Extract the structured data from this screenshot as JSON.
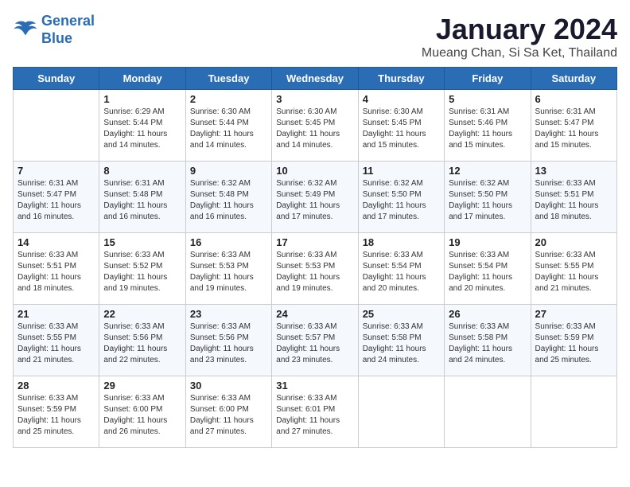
{
  "header": {
    "logo_line1": "General",
    "logo_line2": "Blue",
    "month": "January 2024",
    "location": "Mueang Chan, Si Sa Ket, Thailand"
  },
  "days_of_week": [
    "Sunday",
    "Monday",
    "Tuesday",
    "Wednesday",
    "Thursday",
    "Friday",
    "Saturday"
  ],
  "weeks": [
    [
      {
        "day": "",
        "info": ""
      },
      {
        "day": "1",
        "info": "Sunrise: 6:29 AM\nSunset: 5:44 PM\nDaylight: 11 hours\nand 14 minutes."
      },
      {
        "day": "2",
        "info": "Sunrise: 6:30 AM\nSunset: 5:44 PM\nDaylight: 11 hours\nand 14 minutes."
      },
      {
        "day": "3",
        "info": "Sunrise: 6:30 AM\nSunset: 5:45 PM\nDaylight: 11 hours\nand 14 minutes."
      },
      {
        "day": "4",
        "info": "Sunrise: 6:30 AM\nSunset: 5:45 PM\nDaylight: 11 hours\nand 15 minutes."
      },
      {
        "day": "5",
        "info": "Sunrise: 6:31 AM\nSunset: 5:46 PM\nDaylight: 11 hours\nand 15 minutes."
      },
      {
        "day": "6",
        "info": "Sunrise: 6:31 AM\nSunset: 5:47 PM\nDaylight: 11 hours\nand 15 minutes."
      }
    ],
    [
      {
        "day": "7",
        "info": "Sunrise: 6:31 AM\nSunset: 5:47 PM\nDaylight: 11 hours\nand 16 minutes."
      },
      {
        "day": "8",
        "info": "Sunrise: 6:31 AM\nSunset: 5:48 PM\nDaylight: 11 hours\nand 16 minutes."
      },
      {
        "day": "9",
        "info": "Sunrise: 6:32 AM\nSunset: 5:48 PM\nDaylight: 11 hours\nand 16 minutes."
      },
      {
        "day": "10",
        "info": "Sunrise: 6:32 AM\nSunset: 5:49 PM\nDaylight: 11 hours\nand 17 minutes."
      },
      {
        "day": "11",
        "info": "Sunrise: 6:32 AM\nSunset: 5:50 PM\nDaylight: 11 hours\nand 17 minutes."
      },
      {
        "day": "12",
        "info": "Sunrise: 6:32 AM\nSunset: 5:50 PM\nDaylight: 11 hours\nand 17 minutes."
      },
      {
        "day": "13",
        "info": "Sunrise: 6:33 AM\nSunset: 5:51 PM\nDaylight: 11 hours\nand 18 minutes."
      }
    ],
    [
      {
        "day": "14",
        "info": "Sunrise: 6:33 AM\nSunset: 5:51 PM\nDaylight: 11 hours\nand 18 minutes."
      },
      {
        "day": "15",
        "info": "Sunrise: 6:33 AM\nSunset: 5:52 PM\nDaylight: 11 hours\nand 19 minutes."
      },
      {
        "day": "16",
        "info": "Sunrise: 6:33 AM\nSunset: 5:53 PM\nDaylight: 11 hours\nand 19 minutes."
      },
      {
        "day": "17",
        "info": "Sunrise: 6:33 AM\nSunset: 5:53 PM\nDaylight: 11 hours\nand 19 minutes."
      },
      {
        "day": "18",
        "info": "Sunrise: 6:33 AM\nSunset: 5:54 PM\nDaylight: 11 hours\nand 20 minutes."
      },
      {
        "day": "19",
        "info": "Sunrise: 6:33 AM\nSunset: 5:54 PM\nDaylight: 11 hours\nand 20 minutes."
      },
      {
        "day": "20",
        "info": "Sunrise: 6:33 AM\nSunset: 5:55 PM\nDaylight: 11 hours\nand 21 minutes."
      }
    ],
    [
      {
        "day": "21",
        "info": "Sunrise: 6:33 AM\nSunset: 5:55 PM\nDaylight: 11 hours\nand 21 minutes."
      },
      {
        "day": "22",
        "info": "Sunrise: 6:33 AM\nSunset: 5:56 PM\nDaylight: 11 hours\nand 22 minutes."
      },
      {
        "day": "23",
        "info": "Sunrise: 6:33 AM\nSunset: 5:56 PM\nDaylight: 11 hours\nand 23 minutes."
      },
      {
        "day": "24",
        "info": "Sunrise: 6:33 AM\nSunset: 5:57 PM\nDaylight: 11 hours\nand 23 minutes."
      },
      {
        "day": "25",
        "info": "Sunrise: 6:33 AM\nSunset: 5:58 PM\nDaylight: 11 hours\nand 24 minutes."
      },
      {
        "day": "26",
        "info": "Sunrise: 6:33 AM\nSunset: 5:58 PM\nDaylight: 11 hours\nand 24 minutes."
      },
      {
        "day": "27",
        "info": "Sunrise: 6:33 AM\nSunset: 5:59 PM\nDaylight: 11 hours\nand 25 minutes."
      }
    ],
    [
      {
        "day": "28",
        "info": "Sunrise: 6:33 AM\nSunset: 5:59 PM\nDaylight: 11 hours\nand 25 minutes."
      },
      {
        "day": "29",
        "info": "Sunrise: 6:33 AM\nSunset: 6:00 PM\nDaylight: 11 hours\nand 26 minutes."
      },
      {
        "day": "30",
        "info": "Sunrise: 6:33 AM\nSunset: 6:00 PM\nDaylight: 11 hours\nand 27 minutes."
      },
      {
        "day": "31",
        "info": "Sunrise: 6:33 AM\nSunset: 6:01 PM\nDaylight: 11 hours\nand 27 minutes."
      },
      {
        "day": "",
        "info": ""
      },
      {
        "day": "",
        "info": ""
      },
      {
        "day": "",
        "info": ""
      }
    ]
  ]
}
